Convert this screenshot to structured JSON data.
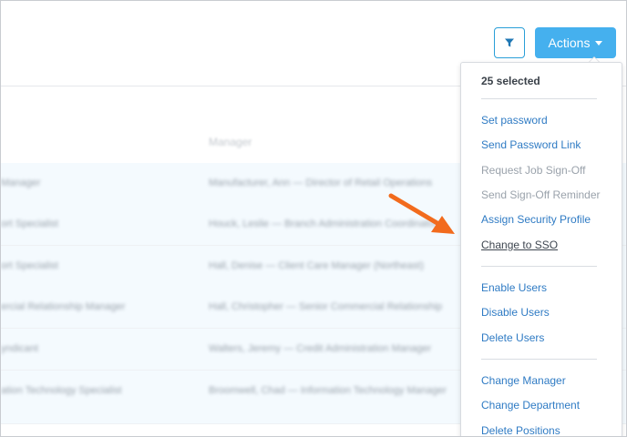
{
  "toolbar": {
    "filter_icon": "filter-icon",
    "actions_label": "Actions"
  },
  "table": {
    "manager_header": "Manager",
    "rows": [
      {
        "title": "Manager",
        "manager": "Manufacturer, Ann — Director of Retail Operations"
      },
      {
        "title": "ort Specialist",
        "manager": "Houck, Leslie — Branch Administration Coordinator"
      },
      {
        "title": "ort Specialist",
        "manager": "Hall, Denise — Client Care Manager (Northeast)"
      },
      {
        "title": "ercial Relationship Manager",
        "manager": "Hall, Christopher — Senior Commercial Relationship"
      },
      {
        "title": "yndicant",
        "manager": "Walters, Jeremy — Credit Administration Manager"
      },
      {
        "title": "ation Technology Specialist",
        "manager": "Broomwell, Chad — Information Technology Manager"
      }
    ]
  },
  "dropdown": {
    "selected_count": "25 selected",
    "groups": [
      [
        {
          "label": "Set password",
          "disabled": false
        },
        {
          "label": "Send Password Link",
          "disabled": false
        },
        {
          "label": "Request Job Sign-Off",
          "disabled": true
        },
        {
          "label": "Send Sign-Off Reminder",
          "disabled": true
        },
        {
          "label": "Assign Security Profile",
          "disabled": false
        },
        {
          "label": "Change to SSO",
          "disabled": false
        }
      ],
      [
        {
          "label": "Enable Users",
          "disabled": false
        },
        {
          "label": "Disable Users",
          "disabled": false
        },
        {
          "label": "Delete Users",
          "disabled": false
        }
      ],
      [
        {
          "label": "Change Manager",
          "disabled": false
        },
        {
          "label": "Change Department",
          "disabled": false
        },
        {
          "label": "Delete Positions",
          "disabled": false
        }
      ]
    ]
  },
  "colors": {
    "accent": "#45b0ee",
    "link": "#2f7bc4",
    "arrow": "#f26b1d",
    "row_highlight": "#f4fafe"
  }
}
